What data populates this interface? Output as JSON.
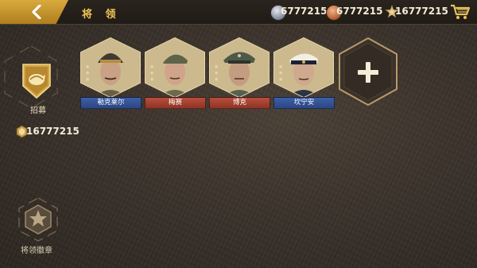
{
  "header": {
    "title": "将 领",
    "back_icon": "chevron-left-icon"
  },
  "resources": [
    {
      "icon": "silver-medal-icon",
      "value": "6777215",
      "color": "#9aa0ab"
    },
    {
      "icon": "bronze-medal-icon",
      "value": "6777215",
      "color": "#b86a3c"
    },
    {
      "icon": "star-medal-icon",
      "value": "16777215",
      "color": "#c9a24f"
    }
  ],
  "shop": {
    "icon": "shopping-cart-icon"
  },
  "sidebar": {
    "recruit_label": "招募",
    "recruit_icon": "recruit-emblem-icon",
    "gold_value": "16777215",
    "gold_icon": "gold-coin-icon",
    "insignia_label": "将领徽章",
    "insignia_icon": "general-insignia-icon"
  },
  "generals": [
    {
      "name": "勒克莱尔",
      "faction": "blue",
      "stars": 3,
      "portrait": "leclerc-portrait"
    },
    {
      "name": "梅赛",
      "faction": "red",
      "stars": 3,
      "portrait": "messe-portrait"
    },
    {
      "name": "博克",
      "faction": "red",
      "stars": 3,
      "portrait": "bock-portrait"
    },
    {
      "name": "坎宁安",
      "faction": "blue",
      "stars": 3,
      "portrait": "cunningham-portrait"
    }
  ],
  "add_slot": {
    "icon": "plus-icon"
  },
  "colors": {
    "accent_gold": "#f0c656",
    "back_button": "#c8942e",
    "frame_gold": "#c9a968",
    "allies_blue": "#3e5fa8",
    "axis_red": "#b84e3c"
  }
}
